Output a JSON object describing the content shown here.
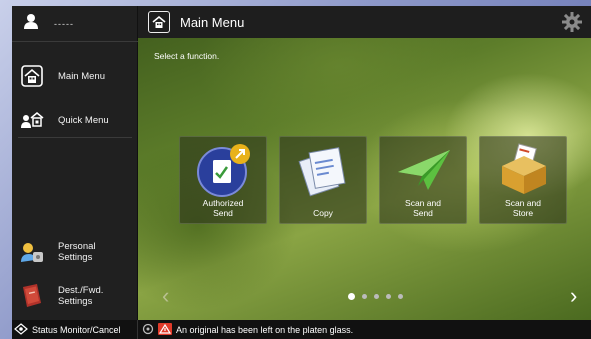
{
  "user": {
    "name": "-----"
  },
  "sidebar": {
    "items": [
      {
        "label": "Main Menu",
        "icon": "home-icon"
      },
      {
        "label": "Quick Menu",
        "icon": "quick-menu-icon"
      },
      {
        "label_line1": "Personal",
        "label_line2": "Settings",
        "icon": "personal-settings-icon"
      },
      {
        "label_line1": "Dest./Fwd.",
        "label_line2": "Settings",
        "icon": "dest-fwd-settings-icon"
      }
    ]
  },
  "header": {
    "title": "Main Menu"
  },
  "main": {
    "prompt": "Select a function.",
    "tiles": [
      {
        "line1": "Authorized",
        "line2": "Send",
        "icon": "authorized-send-icon"
      },
      {
        "line1": "Copy",
        "line2": "",
        "icon": "copy-icon"
      },
      {
        "line1": "Scan and",
        "line2": "Send",
        "icon": "scan-and-send-icon"
      },
      {
        "line1": "Scan and",
        "line2": "Store",
        "icon": "scan-and-store-icon"
      }
    ],
    "page_count": 5,
    "current_page": 1
  },
  "statusbar": {
    "button_label": "Status Monitor/Cancel",
    "message": "An original has been left on the platen glass."
  },
  "colors": {
    "accent": "#e03a2a",
    "bar": "#1e1e1e"
  }
}
